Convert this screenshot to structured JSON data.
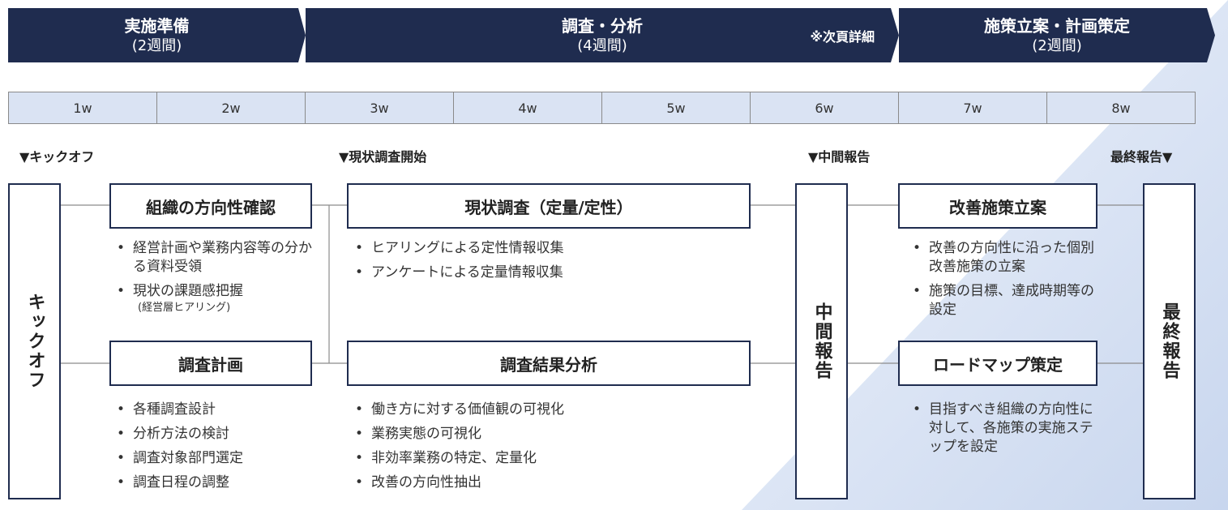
{
  "phases": [
    {
      "title": "実施準備",
      "sub": "(2週間)"
    },
    {
      "title": "調査・分析",
      "sub": "(4週間)",
      "note": "※次頁詳細"
    },
    {
      "title": "施策立案・計画策定",
      "sub": "(2週間)"
    }
  ],
  "weeks": [
    "1w",
    "2w",
    "3w",
    "4w",
    "5w",
    "6w",
    "7w",
    "8w"
  ],
  "milestones": {
    "kickoff": "▼キックオフ",
    "survey_start": "▼現状調査開始",
    "interim": "▼中間報告",
    "final": "最終報告▼"
  },
  "vertical_boxes": {
    "kickoff": "キックオフ",
    "interim": "中間報告",
    "final": "最終報告"
  },
  "tasks": {
    "direction": {
      "title": "組織の方向性確認",
      "bullets": [
        "経営計画や業務内容等の分かる資料受領",
        "現状の課題感把握"
      ],
      "note": "(経営層ヒアリング)"
    },
    "plan": {
      "title": "調査計画",
      "bullets": [
        "各種調査設計",
        "分析方法の検討",
        "調査対象部門選定",
        "調査日程の調整"
      ]
    },
    "survey": {
      "title": "現状調査（定量/定性）",
      "bullets": [
        "ヒアリングによる定性情報収集",
        "アンケートによる定量情報収集"
      ]
    },
    "analysis": {
      "title": "調査結果分析",
      "bullets": [
        "働き方に対する価値観の可視化",
        "業務実態の可視化",
        "非効率業務の特定、定量化",
        "改善の方向性抽出"
      ]
    },
    "measures": {
      "title": "改善施策立案",
      "bullets": [
        "改善の方向性に沿った個別改善施策の立案",
        "施策の目標、達成時期等の設定"
      ]
    },
    "roadmap": {
      "title": "ロードマップ策定",
      "bullets": [
        "目指すべき組織の方向性に対して、各施策の実施ステップを設定"
      ]
    }
  },
  "colors": {
    "navy": "#1f2c4f",
    "week_fill": "#dae3f3",
    "background_gradient": [
      "#eef3fb",
      "#c9d7ee"
    ]
  }
}
